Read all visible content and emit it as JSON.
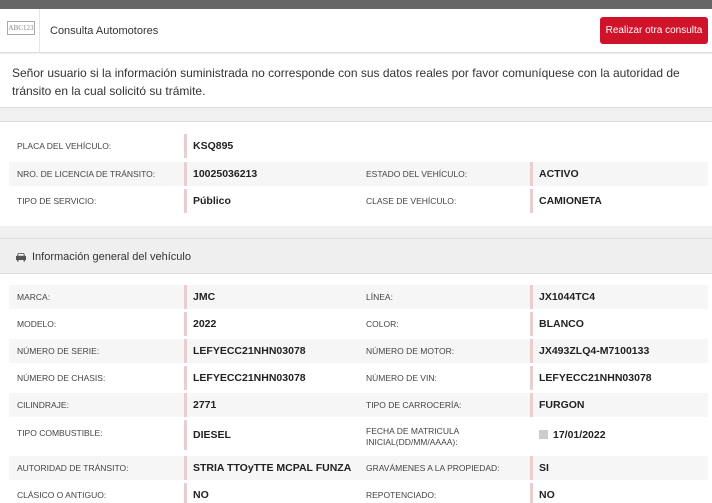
{
  "header": {
    "logo_text": "ABC123",
    "title": "Consulta Automotores",
    "action_button": "Realizar otra consulta"
  },
  "notice": "Señor usuario si la información suministrada no corresponde con sus datos reales por favor comuníquese con la autoridad de tránsito en la cual solicitó su trámite.",
  "summary": {
    "placa_label": "PLACA DEL VEHÍCULO:",
    "placa_value": "KSQ895",
    "licencia_label": "NRO. DE LICENCIA DE TRÁNSITO:",
    "licencia_value": "10025036213",
    "estado_label": "ESTADO DEL VEHÍCULO:",
    "estado_value": "ACTIVO",
    "servicio_label": "TIPO DE SERVICIO:",
    "servicio_value": "Público",
    "clase_label": "CLASE DE VEHÍCULO:",
    "clase_value": "CAMIONETA"
  },
  "general": {
    "title": "Información general del vehículo",
    "car_icon": "car-icon",
    "marca_label": "MARCA:",
    "marca_value": "JMC",
    "linea_label": "LÍNEA:",
    "linea_value": "JX1044TC4",
    "modelo_label": "MODELO:",
    "modelo_value": "2022",
    "color_label": "COLOR:",
    "color_value": "BLANCO",
    "serie_label": "NÚMERO DE SERIE:",
    "serie_value": "LEFYECC21NHN03078",
    "motor_label": "NÚMERO DE MOTOR:",
    "motor_value": "JX493ZLQ4-M7100133",
    "chasis_label": "NÚMERO DE CHASIS:",
    "chasis_value": "LEFYECC21NHN03078",
    "vin_label": "NÚMERO DE VIN:",
    "vin_value": "LEFYECC21NHN03078",
    "cilindraje_label": "CILINDRAJE:",
    "cilindraje_value": "2771",
    "carroceria_label": "TIPO DE CARROCERÍA:",
    "carroceria_value": "FURGON",
    "combustible_label": "TIPO COMBUSTIBLE:",
    "combustible_value": "DIESEL",
    "matricula_label_1": "FECHA DE MATRICULA",
    "matricula_label_2": "INICIAL(DD/MM/AAAA):",
    "matricula_value": "17/01/2022",
    "autoridad_label": "AUTORIDAD DE TRÁNSITO:",
    "autoridad_value": "STRIA TTOyTTE MCPAL FUNZA",
    "gravamenes_label": "GRAVÁMENES A LA PROPIEDAD:",
    "gravamenes_value": "SI",
    "clasico_label": "CLÁSICO O ANTIGUO:",
    "clasico_value": "NO",
    "repotenciado_label": "REPOTENCIADO:",
    "repotenciado_value": "NO"
  },
  "colors": {
    "accent": "#d0122a",
    "value_border": "#e8cdd1"
  }
}
